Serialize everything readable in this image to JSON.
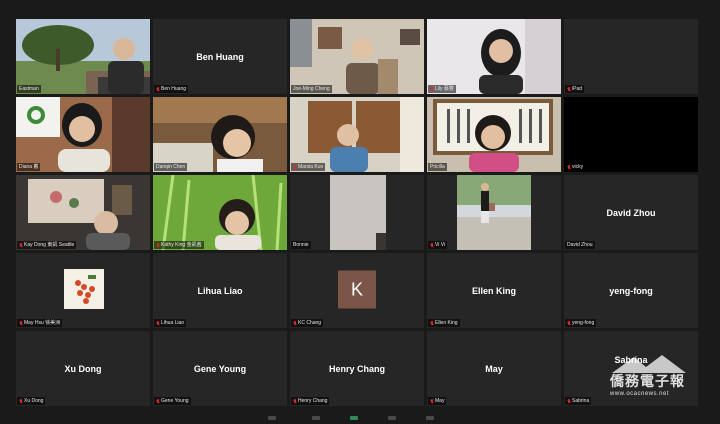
{
  "participants": [
    {
      "name": "Eastman",
      "display": "video"
    },
    {
      "name": "Ben Huang",
      "display": "name"
    },
    {
      "name": "Joe-Ming Cheng",
      "display": "video"
    },
    {
      "name": "Lily 蔡豐",
      "display": "video"
    },
    {
      "name": "iPad",
      "display": "blank"
    },
    {
      "name": "Diana 戴",
      "display": "video"
    },
    {
      "name": "Danqin Chen",
      "display": "video",
      "active": true
    },
    {
      "name": "Marsia Kuo",
      "display": "video"
    },
    {
      "name": "Pricilla",
      "display": "video"
    },
    {
      "name": "vicky",
      "display": "blank"
    },
    {
      "name": "Kay Dong 東凱 Seattle",
      "display": "video"
    },
    {
      "name": "Kathy King 金凱茜",
      "display": "video"
    },
    {
      "name": "Bonnie",
      "display": "video"
    },
    {
      "name": "Vi Vi",
      "display": "video"
    },
    {
      "name": "David Zhou",
      "display": "name"
    },
    {
      "name": "May Hsu 徐美洲",
      "display": "video"
    },
    {
      "name": "Lihua Liao",
      "display": "name"
    },
    {
      "name": "KC Chang",
      "display": "avatar",
      "avatar_letter": "K"
    },
    {
      "name": "Ellen King",
      "display": "name"
    },
    {
      "name": "yeng-fong",
      "display": "name"
    },
    {
      "name": "Xu Dong",
      "display": "name"
    },
    {
      "name": "Gene Young",
      "display": "name"
    },
    {
      "name": "Henry Chang",
      "display": "name"
    },
    {
      "name": "May",
      "display": "name"
    },
    {
      "name": "Sabrina",
      "display": "name"
    }
  ],
  "watermark": {
    "chinese": "僑務電子報",
    "url": "www.ocacnews.net"
  },
  "colors": {
    "tile_bg": "#262626",
    "active_border": "#a3d65b",
    "muted_mic": "#e02828",
    "avatar_bg": "#7a5548"
  }
}
